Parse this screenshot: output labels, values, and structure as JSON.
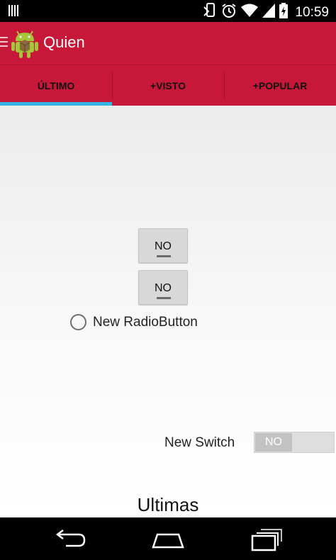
{
  "status_bar": {
    "time": "10:59"
  },
  "action_bar": {
    "title": "Quien"
  },
  "tabs": [
    {
      "label": "ÚLTIMO",
      "active": true
    },
    {
      "label": "+VISTO",
      "active": false
    },
    {
      "label": "+POPULAR",
      "active": false
    }
  ],
  "content": {
    "toggle1_label": "NO",
    "toggle2_label": "NO",
    "radio_label": "New RadioButton",
    "switch_label": "New Switch",
    "switch_state": "NO",
    "section_title": "Ultimas"
  },
  "colors": {
    "primary": "#c8183a",
    "tab_indicator": "#33b5e5"
  },
  "icons": [
    "signal-icon",
    "nfc-icon",
    "alarm-icon",
    "wifi-icon",
    "battery-icon",
    "back-icon",
    "home-icon",
    "recent-apps-icon"
  ]
}
